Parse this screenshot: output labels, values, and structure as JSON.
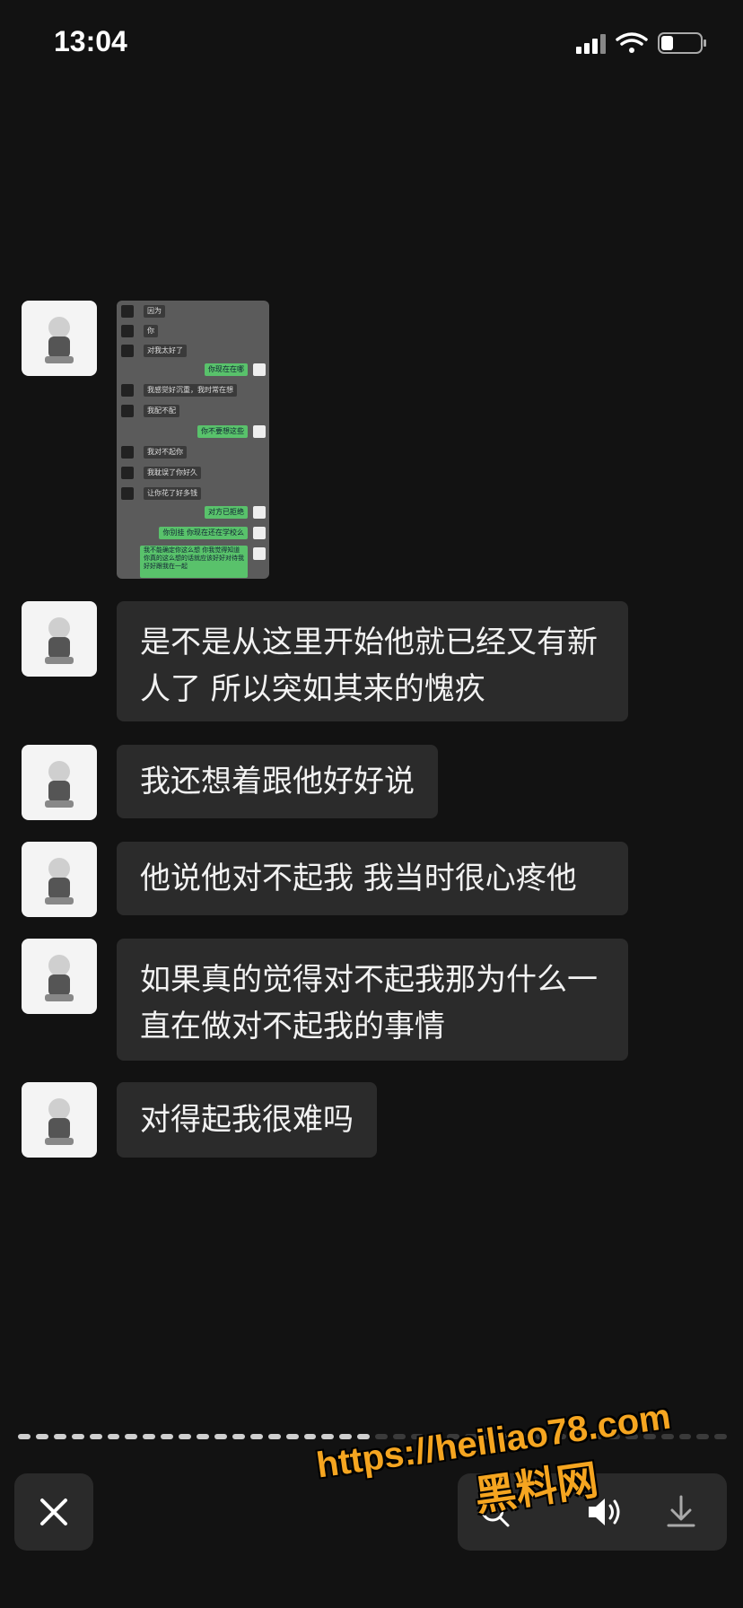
{
  "status_bar": {
    "time": "13:04",
    "icons": [
      "cellular-signal-icon",
      "wifi-icon",
      "battery-icon"
    ]
  },
  "messages": [
    {
      "type": "image",
      "thumbnail_lines": [
        "因为",
        "你",
        "对我太好了",
        "你现在在哪",
        "我感觉好沉重，我时常在想",
        "我配不配",
        "你不要想这些",
        "我对不起你",
        "我耽误了你好久",
        "让你花了好多钱",
        "对方已拒绝",
        "你别挂 你现在还在学校么",
        "我不能确定你这么想 你我觉得知道你真的这么想的话就应该好好对待我好好跟我在一起"
      ]
    },
    {
      "type": "text",
      "text": "是不是从这里开始他就已经又有新人了 所以突如其来的愧疚"
    },
    {
      "type": "text",
      "text": "我还想着跟他好好说"
    },
    {
      "type": "text",
      "text": "他说他对不起我 我当时很心疼他"
    },
    {
      "type": "text",
      "text": "如果真的觉得对不起我那为什么一直在做对不起我的事情"
    },
    {
      "type": "text",
      "text": "对得起我很难吗"
    }
  ],
  "progress": {
    "total_segments": 40,
    "completed_segments": 20
  },
  "bottom_bar": {
    "close_icon": "close-icon",
    "actions": [
      "search-icon",
      "volume-icon",
      "download-icon"
    ]
  },
  "watermark": {
    "line1": "https://heiliao78.com",
    "line2": "黑料网"
  },
  "colors": {
    "background": "#121212",
    "bubble": "#2b2b2b",
    "watermark": "#f5a520",
    "thumb_green": "#59c26b"
  }
}
